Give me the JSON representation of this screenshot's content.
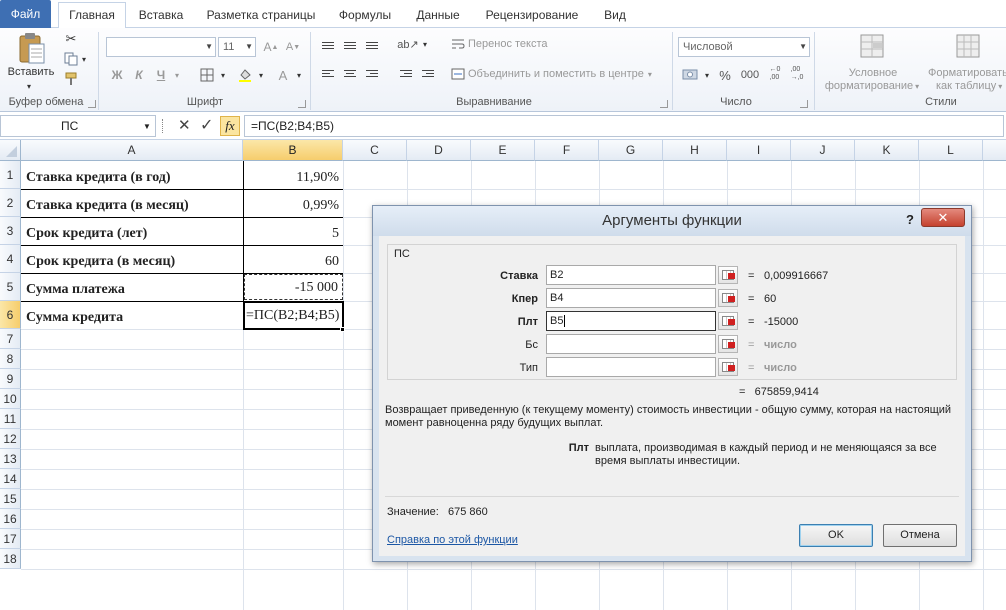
{
  "ribbon_tabs": {
    "file": "Файл",
    "home": "Главная",
    "insert": "Вставка",
    "layout": "Разметка страницы",
    "formulas": "Формулы",
    "data": "Данные",
    "review": "Рецензирование",
    "view": "Вид"
  },
  "ribbon": {
    "paste_label": "Вставить",
    "groups": {
      "clipboard": "Буфер обмена",
      "font": "Шрифт",
      "alignment": "Выравнивание",
      "number": "Число",
      "styles": "Стили"
    },
    "font_size": "11",
    "bold": "Ж",
    "italic": "К",
    "underline": "Ч",
    "wrap_text": "Перенос текста",
    "merge_center": "Объединить и поместить в центре",
    "number_format": "Числовой",
    "cond_format_1": "Условное",
    "cond_format_2": "форматирование",
    "format_table_1": "Форматировать",
    "format_table_2": "как таблицу"
  },
  "formula_bar": {
    "name_box": "ПС",
    "formula": "=ПС(B2;B4;B5)",
    "fx": "fx"
  },
  "sheet": {
    "columns": [
      "A",
      "B",
      "C",
      "D",
      "E",
      "F",
      "G",
      "H",
      "I",
      "J",
      "K",
      "L"
    ],
    "rows": [
      "1",
      "2",
      "3",
      "4",
      "5",
      "6",
      "7",
      "8",
      "9",
      "10",
      "11",
      "12",
      "13",
      "14",
      "15",
      "16",
      "17",
      "18"
    ],
    "cells": {
      "a1": "Ставка кредита (в год)",
      "b1": "11,90%",
      "a2": "Ставка кредита (в месяц)",
      "b2": "0,99%",
      "a3": "Срок кредита (лет)",
      "b3": "5",
      "a4": "Срок кредита (в месяц)",
      "b4": "60",
      "a5": "Сумма платежа",
      "b5": "-15 000",
      "a6": "Сумма кредита",
      "b6": "=ПС(B2;B4;B5)"
    }
  },
  "dialog": {
    "title": "Аргументы функции",
    "help": "?",
    "close": "✕",
    "function_name": "ПС",
    "args": [
      {
        "label": "Ставка",
        "value": "B2",
        "result": "0,009916667",
        "bold": true
      },
      {
        "label": "Кпер",
        "value": "B4",
        "result": "60",
        "bold": true
      },
      {
        "label": "Плт",
        "value": "B5",
        "result": "-15000",
        "bold": true
      },
      {
        "label": "Бс",
        "value": "",
        "result": "число",
        "bold": false
      },
      {
        "label": "Тип",
        "value": "",
        "result": "число",
        "bold": false
      }
    ],
    "eq": "=",
    "result": "675859,9414",
    "description": "Возвращает приведенную (к текущему моменту) стоимость инвестиции - общую сумму, которая на настоящий момент равноценна ряду будущих выплат.",
    "param_name": "Плт",
    "param_desc": "выплата, производимая в каждый период и не меняющаяся за все время выплаты инвестиции.",
    "value_label": "Значение:",
    "value": "675 860",
    "help_link": "Справка по этой функции",
    "ok": "OK",
    "cancel": "Отмена"
  }
}
